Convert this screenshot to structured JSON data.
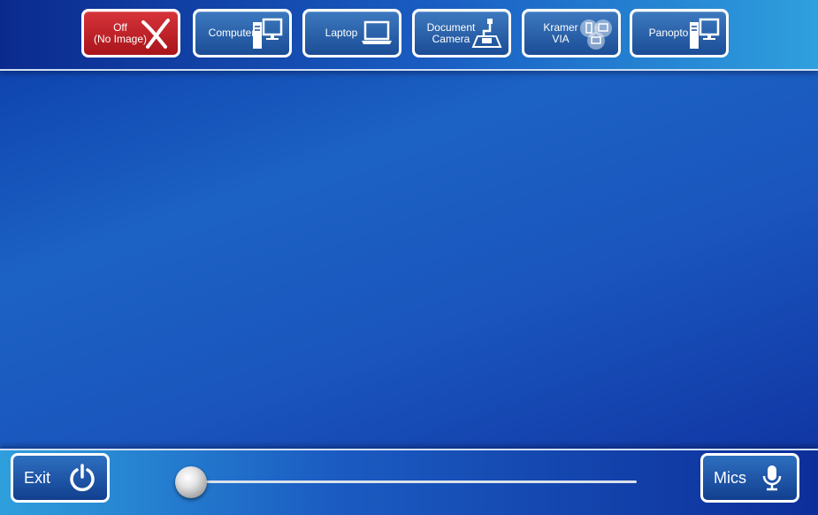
{
  "sources": [
    {
      "label": "Off\n(No Image)",
      "icon": "x-mark-icon",
      "active": true
    },
    {
      "label": "Computer",
      "icon": "desktop-computer-icon",
      "active": false
    },
    {
      "label": "Laptop",
      "icon": "laptop-icon",
      "active": false
    },
    {
      "label": "Document\nCamera",
      "icon": "document-camera-icon",
      "active": false
    },
    {
      "label": "Kramer\nVIA",
      "icon": "wireless-devices-icon",
      "active": false
    },
    {
      "label": "Panopto",
      "icon": "desktop-computer-icon",
      "active": false
    }
  ],
  "footer": {
    "exit_label": "Exit",
    "mics_label": "Mics",
    "volume_level": 0
  },
  "colors": {
    "active_source": "#c0242a",
    "button_blue": "#1b4d96",
    "border": "#ffffff"
  }
}
